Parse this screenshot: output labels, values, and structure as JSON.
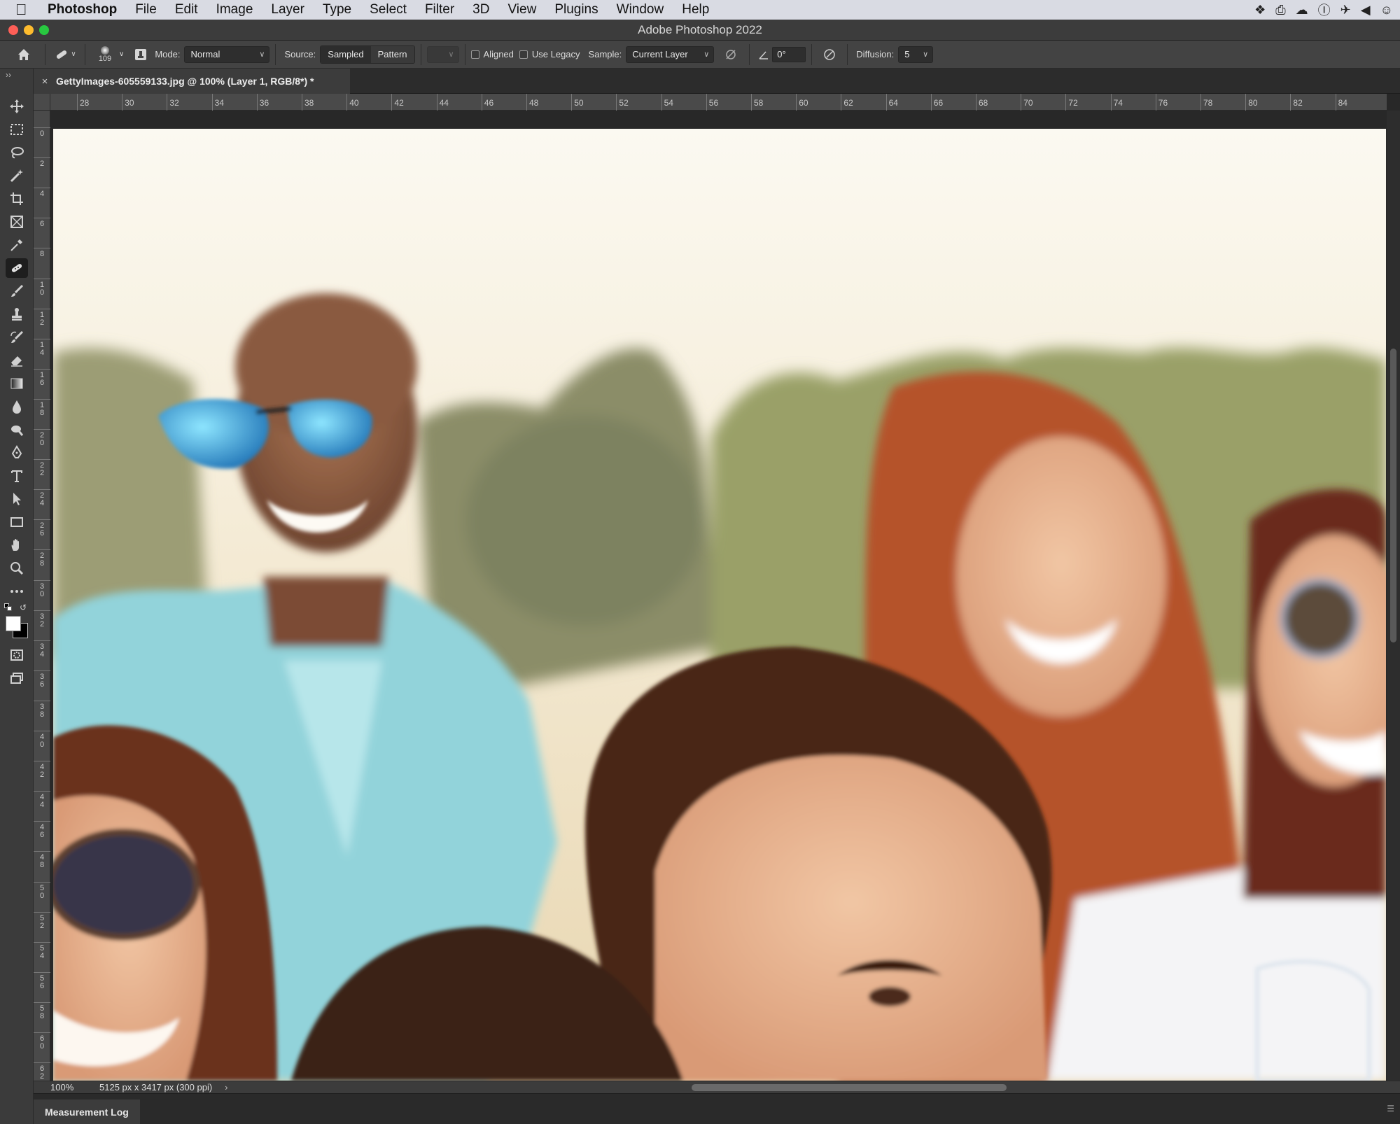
{
  "menubar": {
    "app_name": "Photoshop",
    "items": [
      "File",
      "Edit",
      "Image",
      "Layer",
      "Type",
      "Select",
      "Filter",
      "3D",
      "View",
      "Plugins",
      "Window",
      "Help"
    ],
    "status_icons": [
      "dropbox-icon",
      "printer-icon",
      "creative-cloud-icon",
      "onepassword-icon",
      "rocket-icon",
      "volume-icon",
      "user-icon"
    ]
  },
  "window": {
    "title": "Adobe Photoshop 2022"
  },
  "options": {
    "brush_size": "109",
    "mode_label": "Mode:",
    "mode_value": "Normal",
    "source_label": "Source:",
    "source_sampled": "Sampled",
    "source_pattern": "Pattern",
    "aligned_label": "Aligned",
    "use_legacy_label": "Use Legacy",
    "sample_label": "Sample:",
    "sample_value": "Current Layer",
    "angle_value": "0°",
    "diffusion_label": "Diffusion:",
    "diffusion_value": "5"
  },
  "toolbar": {
    "collapse_glyph": "››",
    "active_tool": "healing-brush-tool",
    "tools": [
      "move",
      "marquee",
      "lasso",
      "magic-wand",
      "crop",
      "frame",
      "eyedropper",
      "healing-brush",
      "brush",
      "clone-stamp",
      "history-brush",
      "eraser",
      "gradient",
      "blur",
      "dodge",
      "pen",
      "type",
      "path-selection",
      "rectangle",
      "hand",
      "zoom",
      "more"
    ],
    "foreground_color": "#ffffff",
    "background_color": "#000000"
  },
  "document": {
    "tab_title": "GettyImages-605559133.jpg @ 100% (Layer 1, RGB/8*) *",
    "close_glyph": "×"
  },
  "rulers": {
    "horizontal": [
      "28",
      "30",
      "32",
      "34",
      "36",
      "38",
      "40",
      "42",
      "44",
      "46",
      "48",
      "50",
      "52",
      "54",
      "56",
      "58",
      "60",
      "62",
      "64",
      "66",
      "68",
      "70",
      "72",
      "74",
      "76",
      "78",
      "80",
      "82",
      "84"
    ],
    "vertical": [
      "0",
      "2",
      "4",
      "6",
      "8",
      "10",
      "12",
      "14",
      "16",
      "18",
      "20",
      "22",
      "24",
      "26",
      "28",
      "30",
      "32",
      "34",
      "36",
      "38",
      "40",
      "42",
      "44",
      "46",
      "48",
      "50",
      "52",
      "54",
      "56",
      "58",
      "60",
      "62"
    ]
  },
  "status": {
    "zoom": "100%",
    "doc_info": "5125 px x 3417 px (300 ppi)",
    "arrow": "›"
  },
  "bottom_panel": {
    "tab": "Measurement Log"
  },
  "colors": {
    "accent_selected_tool": "#1e1e1e",
    "panel_bg": "#434343",
    "canvas_bg": "#282828"
  }
}
